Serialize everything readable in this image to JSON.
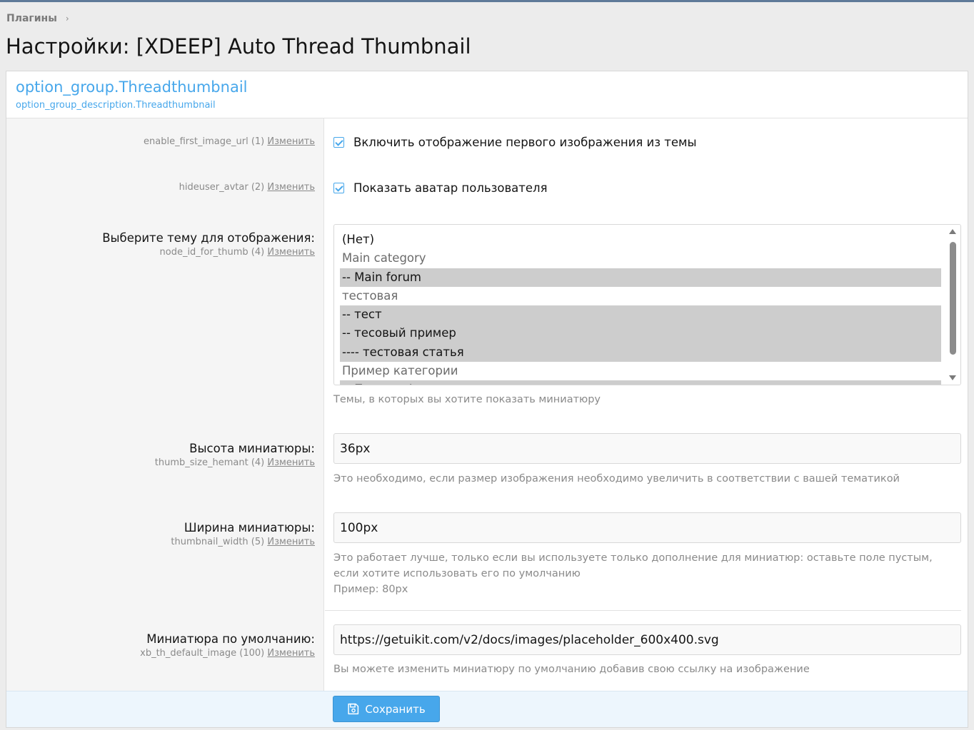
{
  "breadcrumb": {
    "item": "Плагины",
    "separator": "›"
  },
  "page_title": "Настройки: [XDEEP] Auto Thread Thumbnail",
  "group": {
    "title": "option_group.Threadthumbnail",
    "description": "option_group_description.Threadthumbnail"
  },
  "edit_label": "Изменить",
  "options": {
    "enable_first_image": {
      "key": "enable_first_image_url (1)",
      "checkbox_label": "Включить отображение первого изображения из темы",
      "checked": true
    },
    "hideuser_avatar": {
      "key": "hideuser_avtar (2)",
      "checkbox_label": "Показать аватар пользователя",
      "checked": true
    },
    "node_id_for_thumb": {
      "label": "Выберите тему для отображения:",
      "key": "node_id_for_thumb (4)",
      "list": [
        {
          "text": "(Нет)",
          "kind": "plain"
        },
        {
          "text": "Main category",
          "kind": "cat"
        },
        {
          "text": "-- Main forum",
          "kind": "sel"
        },
        {
          "text": "тестовая",
          "kind": "cat"
        },
        {
          "text": "-- тест",
          "kind": "sel"
        },
        {
          "text": "-- тесовый пример",
          "kind": "sel"
        },
        {
          "text": "---- тестовая статья",
          "kind": "sel"
        },
        {
          "text": "Пример категории",
          "kind": "cat"
        },
        {
          "text": "-- Пример форума",
          "kind": "sel"
        }
      ],
      "hint": "Темы, в которых вы хотите показать миниатюру"
    },
    "thumb_size": {
      "label": "Высота миниатюры:",
      "key": "thumb_size_hemant (4)",
      "value": "36px",
      "hint": "Это необходимо, если размер изображения необходимо увеличить в соответствии с вашей тематикой"
    },
    "thumbnail_width": {
      "label": "Ширина миниатюры:",
      "key": "thumbnail_width (5)",
      "value": "100px",
      "hint": "Это работает лучше, только если вы используете только дополнение для миниатюр: оставьте поле пустым, если хотите использовать его по умолчанию",
      "example": "Пример: 80px"
    },
    "default_image": {
      "label": "Миниатюра по умолчанию:",
      "key": "xb_th_default_image (100)",
      "value": "https://getuikit.com/v2/docs/images/placeholder_600x400.svg",
      "hint": "Вы можете изменить миниатюру по умолчанию добавив свою ссылку на изображение"
    }
  },
  "save_button": {
    "label": "Сохранить",
    "icon": "save-icon"
  },
  "colors": {
    "accent": "#47a7eb",
    "footer_bg": "#edf6fd",
    "page_bg": "#ececec"
  }
}
